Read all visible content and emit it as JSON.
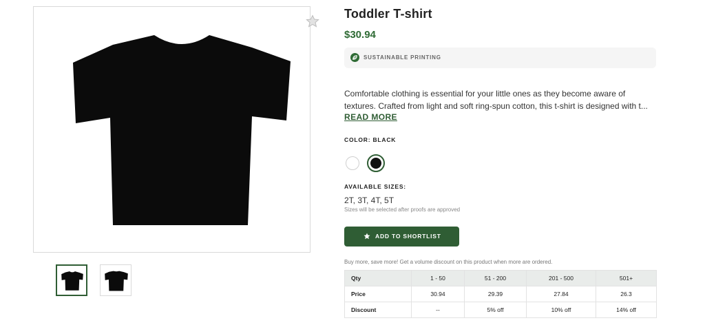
{
  "product": {
    "title": "Toddler T-shirt",
    "price": "$30.94",
    "badge": {
      "icon": "leaf-icon",
      "label": "SUSTAINABLE PRINTING"
    },
    "description_lines": [
      "Comfortable clothing is essential for your little ones as they become aware of",
      "textures. Crafted from light and soft ring-spun cotton, this t-shirt is designed with t..."
    ],
    "read_more_label": "READ MORE",
    "color_label": "COLOR: BLACK",
    "colors": [
      {
        "name": "white",
        "hex": "#ffffff",
        "selected": false
      },
      {
        "name": "black",
        "hex": "#111111",
        "selected": true
      }
    ],
    "sizes_label": "AVAILABLE SIZES:",
    "sizes_value": "2T, 3T, 4T, 5T",
    "sizes_note": "Sizes will be selected after proofs are approved",
    "shortlist_button": {
      "icon": "star-icon",
      "label": "ADD TO SHORTLIST"
    },
    "volume_note": "Buy more, save more! Get a volume discount on this product when more are ordered."
  },
  "gallery": {
    "favorite_icon": "star-icon",
    "thumbnails": [
      {
        "name": "front-view",
        "active": true
      },
      {
        "name": "back-view",
        "active": false
      }
    ]
  },
  "price_table": {
    "headers": [
      "Qty",
      "1 - 50",
      "51 - 200",
      "201 - 500",
      "501+"
    ],
    "rows": [
      [
        "Price",
        "30.94",
        "29.39",
        "27.84",
        "26.3"
      ],
      [
        "Discount",
        "--",
        "5% off",
        "10% off",
        "14% off"
      ]
    ]
  },
  "colors": {
    "brand_green": "#2f5d34",
    "price_green": "#2f6b35",
    "table_header_bg": "#e9ecea"
  }
}
